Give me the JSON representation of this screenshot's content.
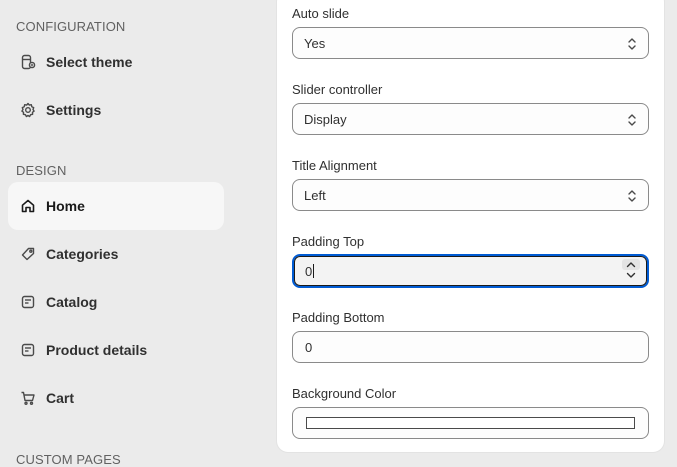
{
  "sidebar": {
    "configuration_title": "CONFIGURATION",
    "configuration_items": [
      {
        "label": "Select theme",
        "icon": "theme-icon"
      },
      {
        "label": "Settings",
        "icon": "gear-icon"
      }
    ],
    "design_title": "DESIGN",
    "design_items": [
      {
        "label": "Home",
        "icon": "home-icon",
        "active": true
      },
      {
        "label": "Categories",
        "icon": "tag-icon"
      },
      {
        "label": "Catalog",
        "icon": "catalog-icon"
      },
      {
        "label": "Product details",
        "icon": "product-details-icon"
      },
      {
        "label": "Cart",
        "icon": "cart-icon"
      }
    ],
    "custom_pages_title": "CUSTOM PAGES"
  },
  "form": {
    "auto_slide": {
      "label": "Auto slide",
      "value": "Yes"
    },
    "slider_controller": {
      "label": "Slider controller",
      "value": "Display"
    },
    "title_alignment": {
      "label": "Title Alignment",
      "value": "Left"
    },
    "padding_top": {
      "label": "Padding Top",
      "value": "0"
    },
    "padding_bottom": {
      "label": "Padding Bottom",
      "value": "0"
    },
    "background_color": {
      "label": "Background Color",
      "value": "#ffffff"
    }
  },
  "colors": {
    "focus_ring": "#005bd3",
    "active_nav_bg": "#f7f7f7",
    "sidebar_bg": "#ebebeb"
  }
}
